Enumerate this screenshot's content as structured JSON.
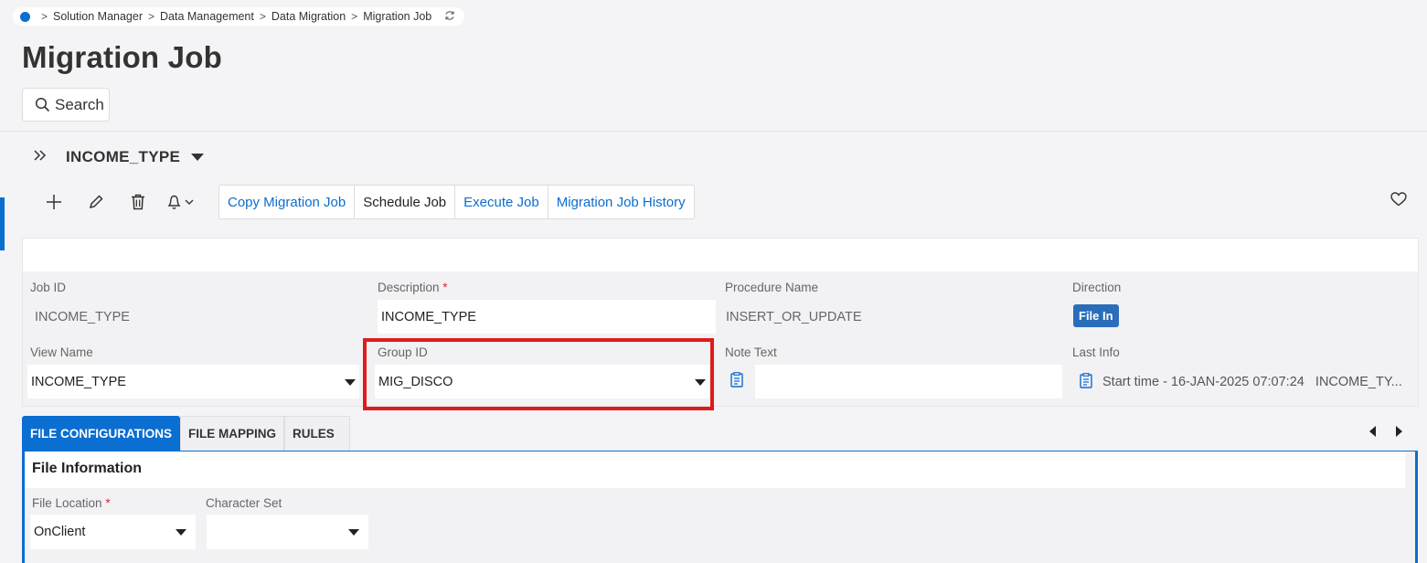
{
  "breadcrumb": {
    "items": [
      "Solution Manager",
      "Data Management",
      "Data Migration",
      "Migration Job"
    ],
    "separator": ">"
  },
  "page": {
    "title": "Migration Job",
    "search_label": "Search"
  },
  "record": {
    "title": "INCOME_TYPE"
  },
  "commands": {
    "copy": "Copy Migration Job",
    "schedule": "Schedule Job",
    "execute": "Execute Job",
    "history": "Migration Job History"
  },
  "fields": {
    "job_id": {
      "label": "Job ID",
      "value": "INCOME_TYPE"
    },
    "description": {
      "label": "Description",
      "required": "*",
      "value": "INCOME_TYPE"
    },
    "procedure_name": {
      "label": "Procedure Name",
      "value": "INSERT_OR_UPDATE"
    },
    "direction": {
      "label": "Direction",
      "value": "File In"
    },
    "view_name": {
      "label": "View Name",
      "value": "INCOME_TYPE"
    },
    "group_id": {
      "label": "Group ID",
      "value": "MIG_DISCO"
    },
    "note_text": {
      "label": "Note Text",
      "value": ""
    },
    "last_info": {
      "label": "Last Info",
      "value": "Start time - 16-JAN-2025 07:07:24   INCOME_TY..."
    }
  },
  "tabs": [
    {
      "label": "FILE CONFIGURATIONS",
      "active": true
    },
    {
      "label": "FILE MAPPING",
      "active": false
    },
    {
      "label": "RULES",
      "active": false
    }
  ],
  "file_info": {
    "title": "File Information",
    "file_location": {
      "label": "File Location",
      "required": "*",
      "value": "OnClient"
    },
    "character_set": {
      "label": "Character Set",
      "value": ""
    }
  },
  "colors": {
    "accent": "#0b6ed1",
    "highlight": "#e01b1b",
    "badge": "#2a6ebb"
  }
}
